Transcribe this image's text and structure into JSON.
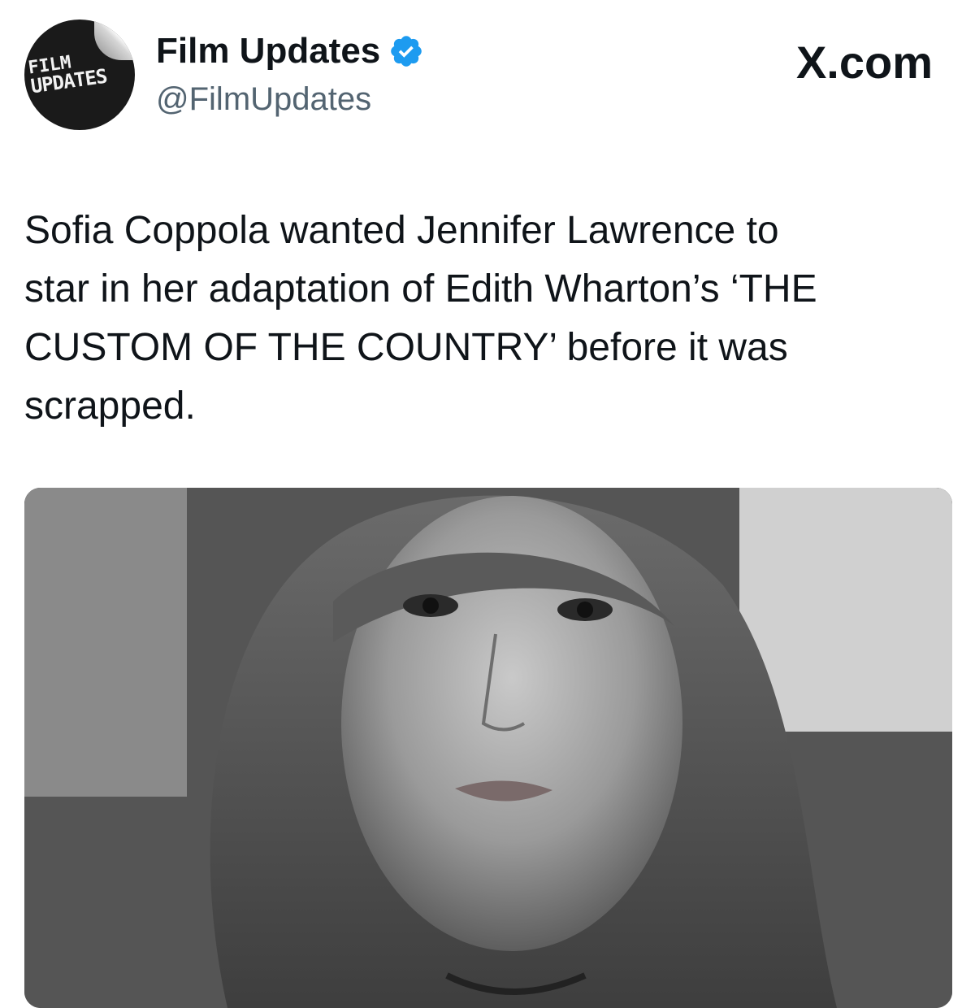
{
  "account": {
    "display_name": "Film Updates",
    "handle": "@FilmUpdates",
    "avatar_lines": [
      "FILM",
      "UPDATES"
    ],
    "verified_icon": "verified-badge-icon",
    "verified_color": "#1d9bf0"
  },
  "site_label": "X.com",
  "tweet": {
    "text": "Sofia Coppola wanted Jennifer Lawrence to\nstar in her adaptation of Edith Wharton’s ‘THE\nCUSTOM OF THE COUNTRY’ before it was\nscrapped."
  },
  "media": {
    "kind": "black-and-white portrait photo"
  },
  "colors": {
    "text_primary": "#0f1419",
    "text_secondary": "#536471"
  }
}
